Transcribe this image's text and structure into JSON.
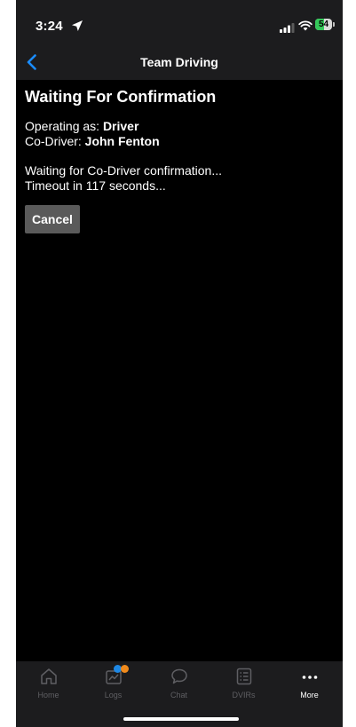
{
  "status_bar": {
    "time": "3:24",
    "battery": "54",
    "battery_level": 0.54,
    "location_icon": "location-arrow-icon",
    "signal_icon": "cellular-signal-icon",
    "wifi_icon": "wifi-icon"
  },
  "nav": {
    "back_icon": "chevron-left-icon",
    "title": "Team Driving"
  },
  "content": {
    "title": "Waiting For Confirmation",
    "operating_label": "Operating as: ",
    "operating_value": "Driver",
    "codriver_label": "Co-Driver: ",
    "codriver_value": "John Fenton",
    "waiting_text": "Waiting for Co-Driver confirmation...",
    "timeout_text": "Timeout in 117 seconds...",
    "cancel_label": "Cancel"
  },
  "tab_bar": {
    "tabs": [
      {
        "label": "Home",
        "icon": "home-icon",
        "active": false
      },
      {
        "label": "Logs",
        "icon": "logs-icon",
        "active": false
      },
      {
        "label": "Chat",
        "icon": "chat-bubble-icon",
        "active": false
      },
      {
        "label": "DVIRs",
        "icon": "checklist-icon",
        "active": false
      },
      {
        "label": "More",
        "icon": "more-dots-icon",
        "active": true
      }
    ]
  },
  "colors": {
    "background": "#000000",
    "bar_background": "#1c1c1e",
    "accent": "#1a8cff",
    "button_gray": "#5a5a5a",
    "inactive_tab": "#5f5f63",
    "badge_blue": "#1e88e5",
    "badge_orange": "#f08a1c",
    "battery_green": "#34c759"
  }
}
